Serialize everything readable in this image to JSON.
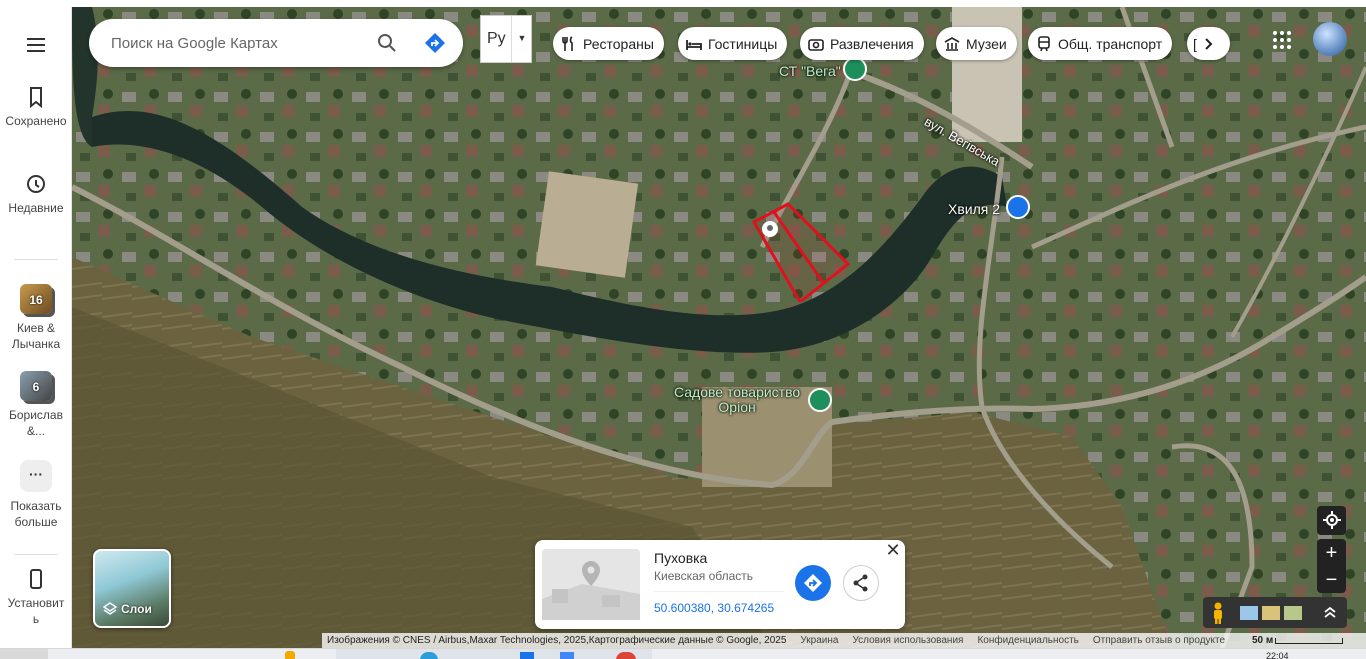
{
  "rail": {
    "menu_icon": "hamburger-menu-icon",
    "saved_label": "Сохранено",
    "recent_label": "Недавние",
    "list1": {
      "count": "16",
      "label": "Киев & Лычанка"
    },
    "list2": {
      "count": "6",
      "label": "Борислав &..."
    },
    "more_label": "Показать больше",
    "install_label": "Установить"
  },
  "search": {
    "placeholder": "Поиск на Google Картах",
    "search_icon": "search-icon",
    "directions_icon": "directions-icon"
  },
  "keyboard": {
    "layout_label": "Ру"
  },
  "chips": [
    {
      "label": "Рестораны",
      "icon": "restaurant-icon"
    },
    {
      "label": "Гостиницы",
      "icon": "hotel-icon"
    },
    {
      "label": "Развлечения",
      "icon": "camera-icon"
    },
    {
      "label": "Музеи",
      "icon": "museum-icon"
    },
    {
      "label": "Общ. транспорт",
      "icon": "transit-icon"
    }
  ],
  "map_labels": {
    "st_vega": "СТ \"Вега\"",
    "street": "вул. Вегівська",
    "khvylia": "Хвиля 2",
    "sadove_line1": "Садове товариство",
    "sadove_line2": "Оріон"
  },
  "layers": {
    "label": "Слои"
  },
  "place_card": {
    "name": "Пуховка",
    "region": "Киевская область",
    "coords": "50.600380, 30.674265"
  },
  "footer": {
    "attribution": "Изображения © CNES / Airbus,Maxar Technologies, 2025,Картографические данные © Google, 2025",
    "country": "Украина",
    "terms": "Условия использования",
    "privacy": "Конфиденциальность",
    "feedback": "Отправить отзыв о продукте",
    "scale": "50 м"
  },
  "taskbar": {
    "clock": "22:04"
  },
  "colors": {
    "accent": "#1a73e8",
    "parcel": "#e0101e",
    "poi_green": "#1e8e5a",
    "poi_blue": "#1a73e8"
  }
}
